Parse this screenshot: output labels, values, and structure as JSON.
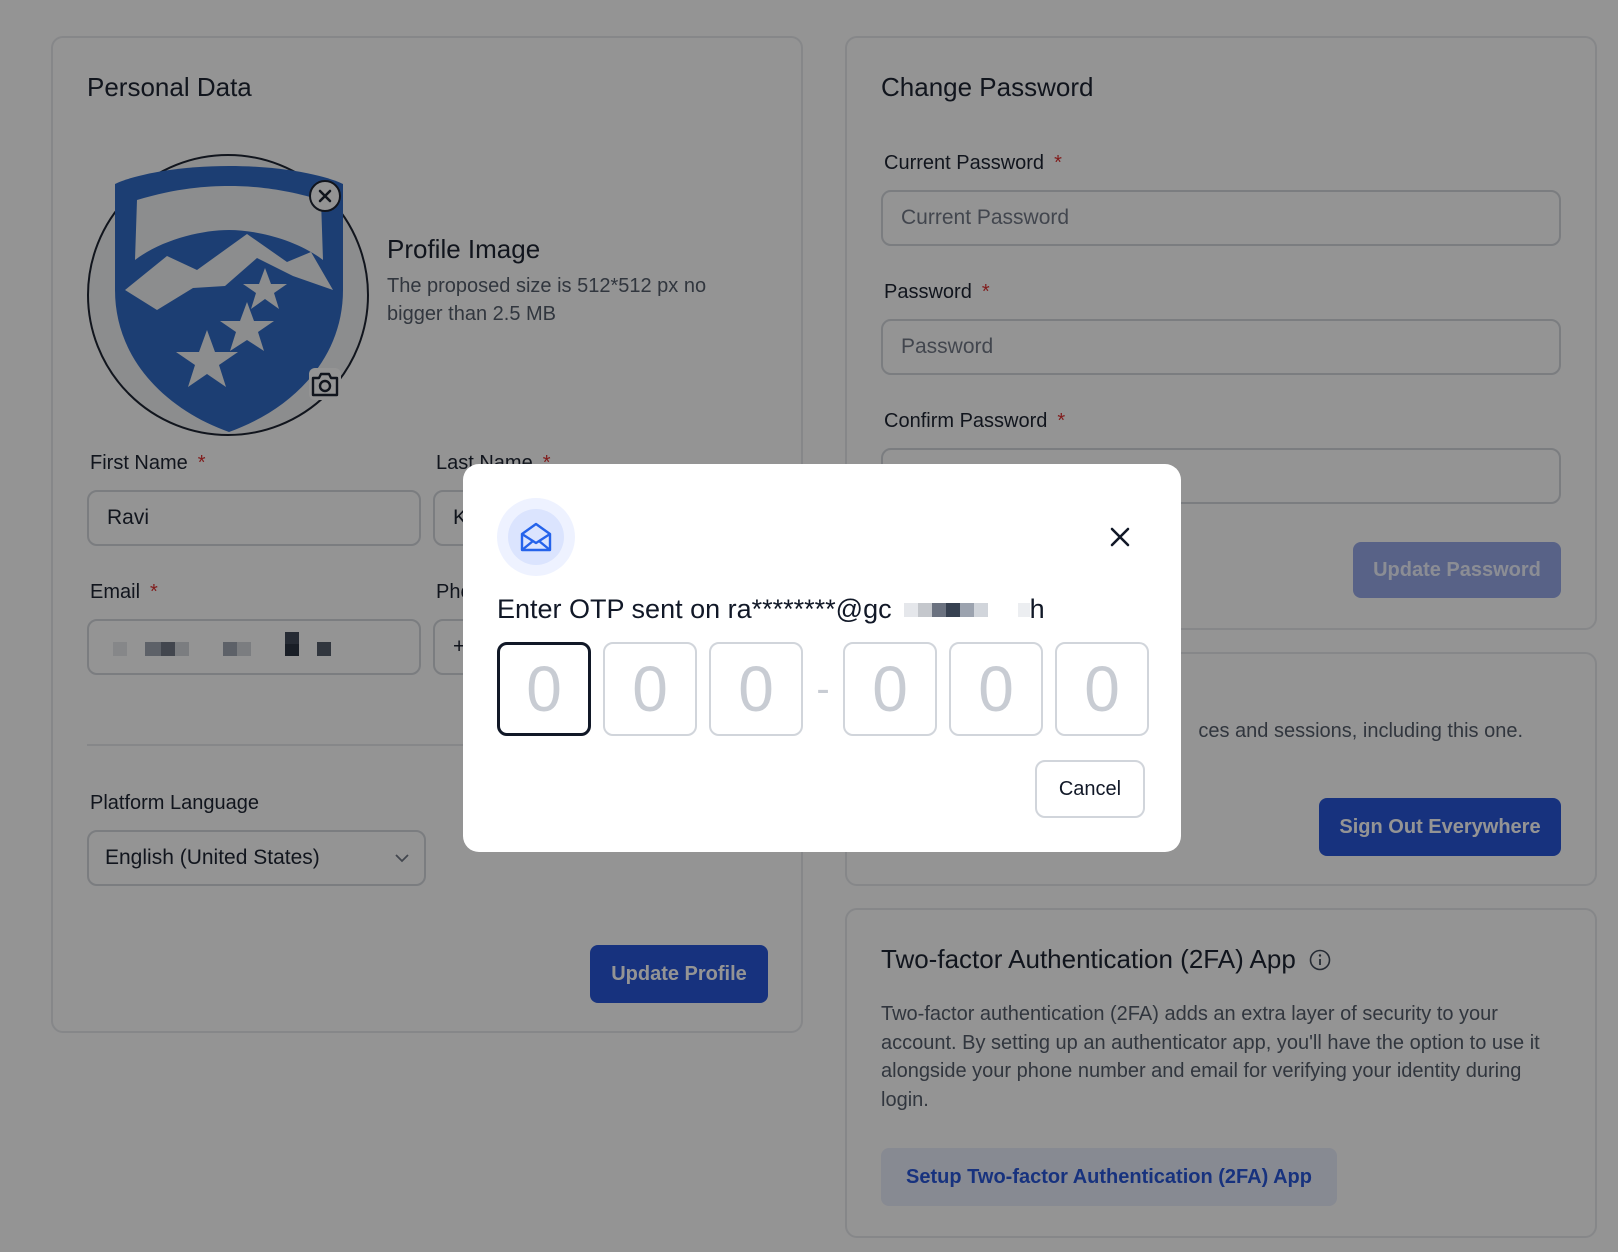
{
  "personal": {
    "title": "Personal Data",
    "profile_image_title": "Profile Image",
    "profile_image_desc": "The proposed size is 512*512 px no bigger than 2.5 MB",
    "first_name_label": "First Name",
    "first_name_value": "Ravi",
    "last_name_label": "Last Name",
    "last_name_value": "K",
    "email_label": "Email",
    "phone_label": "Pho",
    "phone_value": "+",
    "language_label": "Platform Language",
    "language_value": "English (United States)",
    "update_button": "Update Profile",
    "required_mark": "*"
  },
  "password": {
    "title": "Change Password",
    "current_label": "Current Password",
    "current_placeholder": "Current Password",
    "password_label": "Password",
    "password_placeholder": "Password",
    "confirm_label": "Confirm Password",
    "update_button": "Update Password"
  },
  "signout": {
    "desc": "ces and sessions, including this one.",
    "button": "Sign Out Everywhere"
  },
  "twofa": {
    "title": "Two-factor Authentication (2FA) App",
    "desc": "Two-factor authentication (2FA) adds an extra layer of security to your account. By setting up an authenticator app, you'll have the option to use it alongside your phone number and email for verifying your identity during login.",
    "button": "Setup Two-factor Authentication (2FA) App"
  },
  "otp_modal": {
    "title": "Enter OTP sent on ra********@gc",
    "title_tail": "h",
    "digits": [
      "0",
      "0",
      "0",
      "0",
      "0",
      "0"
    ],
    "separator": "-",
    "cancel": "Cancel"
  },
  "colors": {
    "primary": "#1d4ed8",
    "overlay": "rgba(17,17,17,0.45)",
    "required": "#dc2626"
  }
}
